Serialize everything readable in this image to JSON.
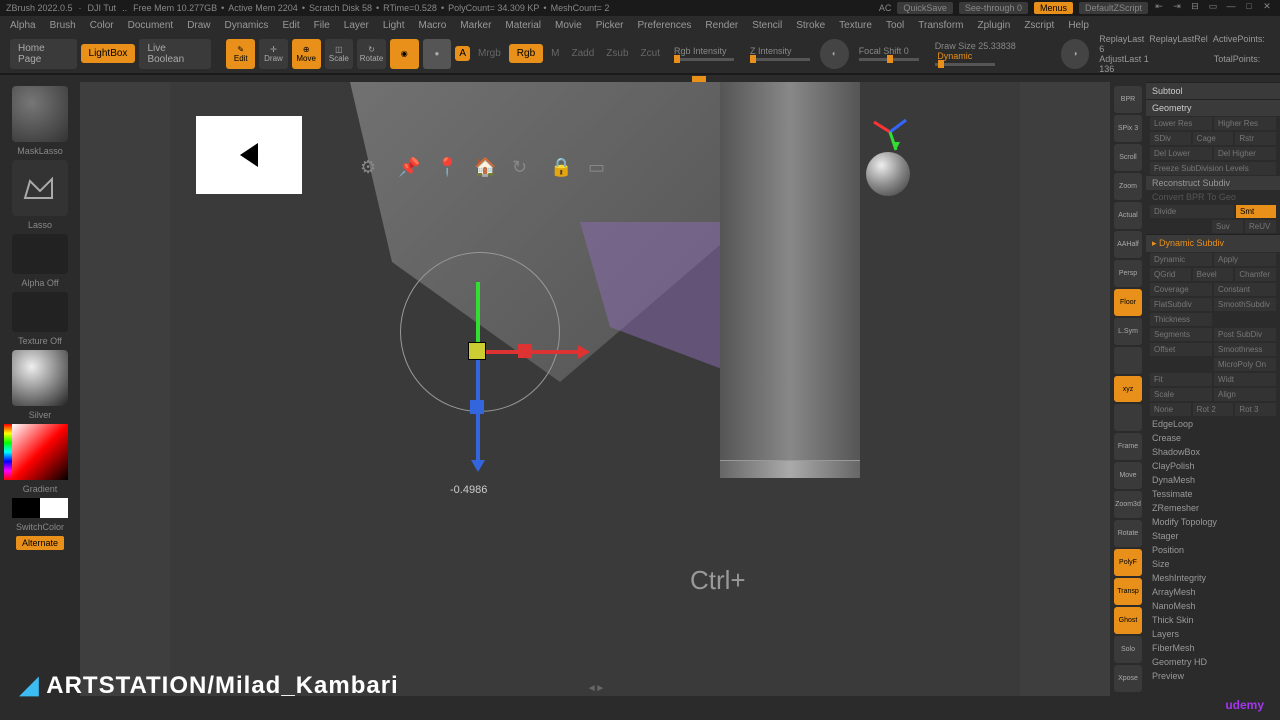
{
  "title_bar": {
    "app": "ZBrush 2022.0.5",
    "doc": "DJI Tut",
    "free_mem": "Free Mem 10.277GB",
    "active_mem": "Active Mem 2204",
    "scratch": "Scratch Disk 58",
    "rtime": "RTime=0.528",
    "poly": "PolyCount= 34.309 KP",
    "mesh": "MeshCount= 2",
    "ac": "AC",
    "quicksave": "QuickSave",
    "seethrough": "See-through  0",
    "menus": "Menus",
    "script": "DefaultZScript"
  },
  "menus": [
    "Alpha",
    "Brush",
    "Color",
    "Document",
    "Draw",
    "Dynamics",
    "Edit",
    "File",
    "Layer",
    "Light",
    "Macro",
    "Marker",
    "Material",
    "Movie",
    "Picker",
    "Preferences",
    "Render",
    "Stencil",
    "Stroke",
    "Texture",
    "Tool",
    "Transform",
    "Zplugin",
    "Zscript",
    "Help"
  ],
  "top": {
    "home": "Home Page",
    "lightbox": "LightBox",
    "liveboolean": "Live Boolean",
    "mode_labels": [
      "Edit",
      "Draw",
      "Move",
      "Scale",
      "Rotate"
    ],
    "sculptris": "A",
    "mrgb": "Mrgb",
    "rgb": "Rgb",
    "m": "M",
    "zadd": "Zadd",
    "zsub": "Zsub",
    "zcut": "Zcut",
    "rgb_int": "Rgb Intensity",
    "z_int": "Z Intensity",
    "focal": "Focal Shift 0",
    "draw": "Draw Size 25.33838",
    "dynamic": "Dynamic",
    "replaylast": "ReplayLast",
    "replaylastrel": "ReplayLastRel",
    "adjustlast": "AdjustLast 1",
    "activepts": "ActivePoints: 6",
    "totalpts": "TotalPoints: 136"
  },
  "left": {
    "masklasso": "MaskLasso",
    "lasso": "Lasso",
    "alphaoff": "Alpha Off",
    "textureoff": "Texture Off",
    "silver": "Silver",
    "gradient": "Gradient",
    "switchcolor": "SwitchColor",
    "alternate": "Alternate"
  },
  "right_tool": [
    "BPR",
    "SPix 3",
    "Scroll",
    "Zoom",
    "Actual",
    "AAHalf",
    "Persp",
    "Floor",
    "L.Sym",
    "",
    "xyz",
    "",
    "Frame",
    "Move",
    "Zoom3d",
    "Rotate",
    "PolyF",
    "Transp",
    "Ghost",
    "Solo",
    "Xpose"
  ],
  "right_tool_active": {
    "Floor": true,
    "xyz": true,
    "PolyF": true,
    "Transp": true,
    "Ghost": true
  },
  "panel": {
    "subtool": "Subtool",
    "geometry": "Geometry",
    "geo_rows": [
      [
        "Lower Res",
        "Higher Res"
      ],
      [
        "SDiv",
        "Cage",
        "Rstr"
      ],
      [
        "Del Lower",
        "Del Higher"
      ],
      [
        "Freeze SubDivision Levels",
        ""
      ]
    ],
    "reconstruct": "Reconstruct Subdiv",
    "convert_bpr": "Convert BPR To Geo",
    "divide_row": [
      "Divide",
      "Smt"
    ],
    "divide_sub": [
      "Suv",
      "ReUV"
    ],
    "dynsub": "Dynamic Subdiv",
    "dyn_rows": [
      [
        "Dynamic",
        "Apply"
      ],
      [
        "QGrid",
        "Bevel",
        "Chamfer"
      ],
      [
        "Coverage",
        "Constant"
      ],
      [
        "FlatSubdiv",
        "SmoothSubdiv"
      ],
      [
        "Thickness",
        ""
      ],
      [
        "Segments",
        "Post SubDiv"
      ],
      [
        "Offset",
        "Smoothness"
      ],
      [
        "",
        "MicroPoly On"
      ],
      [
        "Fit",
        "Widt"
      ],
      [
        "Scale",
        "Align"
      ],
      [
        "None",
        "Rot 2",
        "Rot 3"
      ]
    ],
    "sections": [
      "EdgeLoop",
      "Crease",
      "ShadowBox",
      "ClayPolish",
      "DynaMesh",
      "Tessimate",
      "ZRemesher",
      "Modify Topology",
      "Stager",
      "Position",
      "Size",
      "MeshIntegrity",
      "ArrayMesh",
      "NanoMesh",
      "Thick Skin",
      "Layers",
      "FiberMesh",
      "Geometry HD",
      "Preview"
    ]
  },
  "viewport": {
    "reading": "-0.4986",
    "key_overlay": "Ctrl+",
    "watermark": "ARTSTATION/Milad_Kambari",
    "udemy": "udemy"
  }
}
